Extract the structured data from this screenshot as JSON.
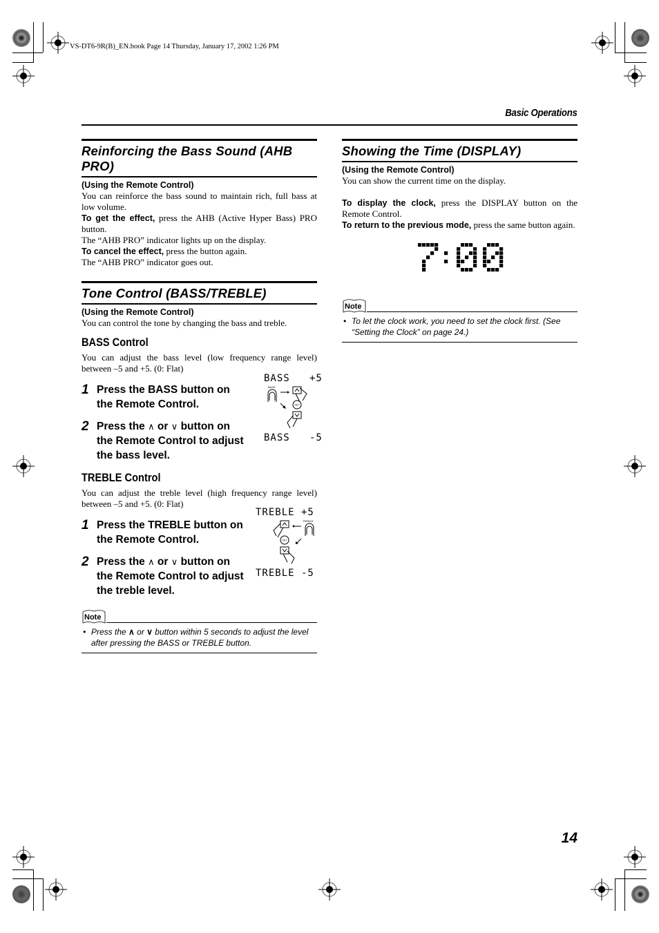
{
  "book_info": "VS-DT6-9R(B)_EN.book  Page 14  Thursday, January 17, 2002  1:26 PM",
  "running_head": "Basic Operations",
  "page_number": "14",
  "left": {
    "ahb": {
      "title": "Reinforcing the Bass Sound (AHB PRO)",
      "subhead": "(Using the Remote Control)",
      "intro": "You can reinforce the bass sound to maintain rich, full bass at low volume.",
      "get_lead": "To get the effect,",
      "get_text": " press the AHB (Active Hyper Bass) PRO button.",
      "get_result": "The “AHB PRO” indicator lights up on the display.",
      "cancel_lead": "To cancel the effect,",
      "cancel_text": " press the button again.",
      "cancel_result": "The “AHB PRO” indicator goes out."
    },
    "tone": {
      "title": "Tone Control (BASS/TREBLE)",
      "subhead": "(Using the Remote Control)",
      "intro": "You can control the tone by changing the bass and treble.",
      "bass": {
        "heading": "BASS Control",
        "desc": "You can adjust the bass level (low frequency range level) between –5 and +5. (0: Flat)",
        "steps": [
          {
            "num": "1",
            "text": "Press the BASS button on the Remote Control."
          },
          {
            "num": "2",
            "pre": "Press the ",
            "up": "∧",
            "mid": " or ",
            "down": "∨",
            "post": " button on the Remote Control to adjust the bass level."
          }
        ],
        "figure": {
          "top_label": "BASS   +5",
          "bottom_label": "BASS   -5",
          "button_label": "BASS",
          "set_label": "SET"
        }
      },
      "treble": {
        "heading": "TREBLE Control",
        "desc": "You can adjust the treble level (high frequency range level) between –5 and +5. (0: Flat)",
        "steps": [
          {
            "num": "1",
            "text": "Press the TREBLE button on the Remote Control."
          },
          {
            "num": "2",
            "pre": "Press the ",
            "up": "∧",
            "mid": " or ",
            "down": "∨",
            "post": " button on the Remote Control to adjust the treble level."
          }
        ],
        "figure": {
          "top_label": "TREBLE +5",
          "bottom_label": "TREBLE -5",
          "button_label": "TREBLE",
          "set_label": "SET"
        }
      },
      "note": {
        "label": "Note",
        "bullet": "•",
        "pre": "Press the ",
        "up": "∧",
        "mid": " or ",
        "down": "∨",
        "post": "  button within 5 seconds to adjust the level after pressing the BASS or TREBLE button."
      }
    }
  },
  "right": {
    "display": {
      "title": "Showing the Time (DISPLAY)",
      "subhead": "(Using the Remote Control)",
      "intro": "You can show the current time on the display.",
      "display_lead": "To display the clock,",
      "display_text": " press the DISPLAY button on the Remote Control.",
      "return_lead": "To return to the previous mode,",
      "return_text": " press the same button again.",
      "clock": "7:00",
      "note": {
        "label": "Note",
        "bullet": "•",
        "text": "To let the clock work, you need to set the clock first. (See “Setting the Clock” on page 24.)"
      }
    }
  }
}
